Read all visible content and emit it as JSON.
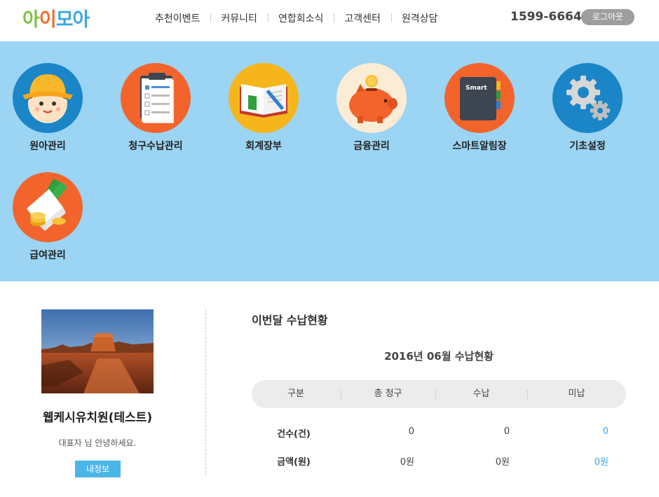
{
  "header": {
    "logo": [
      "아",
      "이",
      "모",
      "아"
    ],
    "nav": [
      "추천이벤트",
      "커뮤니티",
      "연합회소식",
      "고객센터",
      "원격상담"
    ],
    "phone": "1599-6664",
    "logout_label": "로그아웃"
  },
  "menu": [
    {
      "label": "원아관리",
      "icon": "child-icon",
      "color": "#1a86c8"
    },
    {
      "label": "청구수납관리",
      "icon": "clipboard-icon",
      "color": "#f2642c"
    },
    {
      "label": "회계장부",
      "icon": "ledger-book-icon",
      "color": "#f7b51c"
    },
    {
      "label": "금융관리",
      "icon": "piggy-bank-icon",
      "color": "#fbecd6"
    },
    {
      "label": "스마트알림장",
      "icon": "smart-notebook-icon",
      "color": "#f2642c"
    },
    {
      "label": "기초설정",
      "icon": "gear-icon",
      "color": "#1a86c8"
    },
    {
      "label": "급여관리",
      "icon": "money-envelope-icon",
      "color": "#f2642c"
    }
  ],
  "notebook_text": "Smart",
  "profile": {
    "school_name": "웹케시유치원(테스트)",
    "greeting": "대표자 님 안녕하세요.",
    "myinfo_label": "내정보"
  },
  "payment": {
    "section_title": "이번달 수납현황",
    "period_title": "2016년 06월 수납현황",
    "columns": [
      "구분",
      "총 청구",
      "수납",
      "미납"
    ],
    "rows": [
      {
        "label": "건수(건)",
        "total": "0",
        "paid": "0",
        "unpaid": "0"
      },
      {
        "label": "금액(원)",
        "total": "0원",
        "paid": "0원",
        "unpaid": "0원"
      }
    ],
    "accent": "#3aa6e0"
  }
}
